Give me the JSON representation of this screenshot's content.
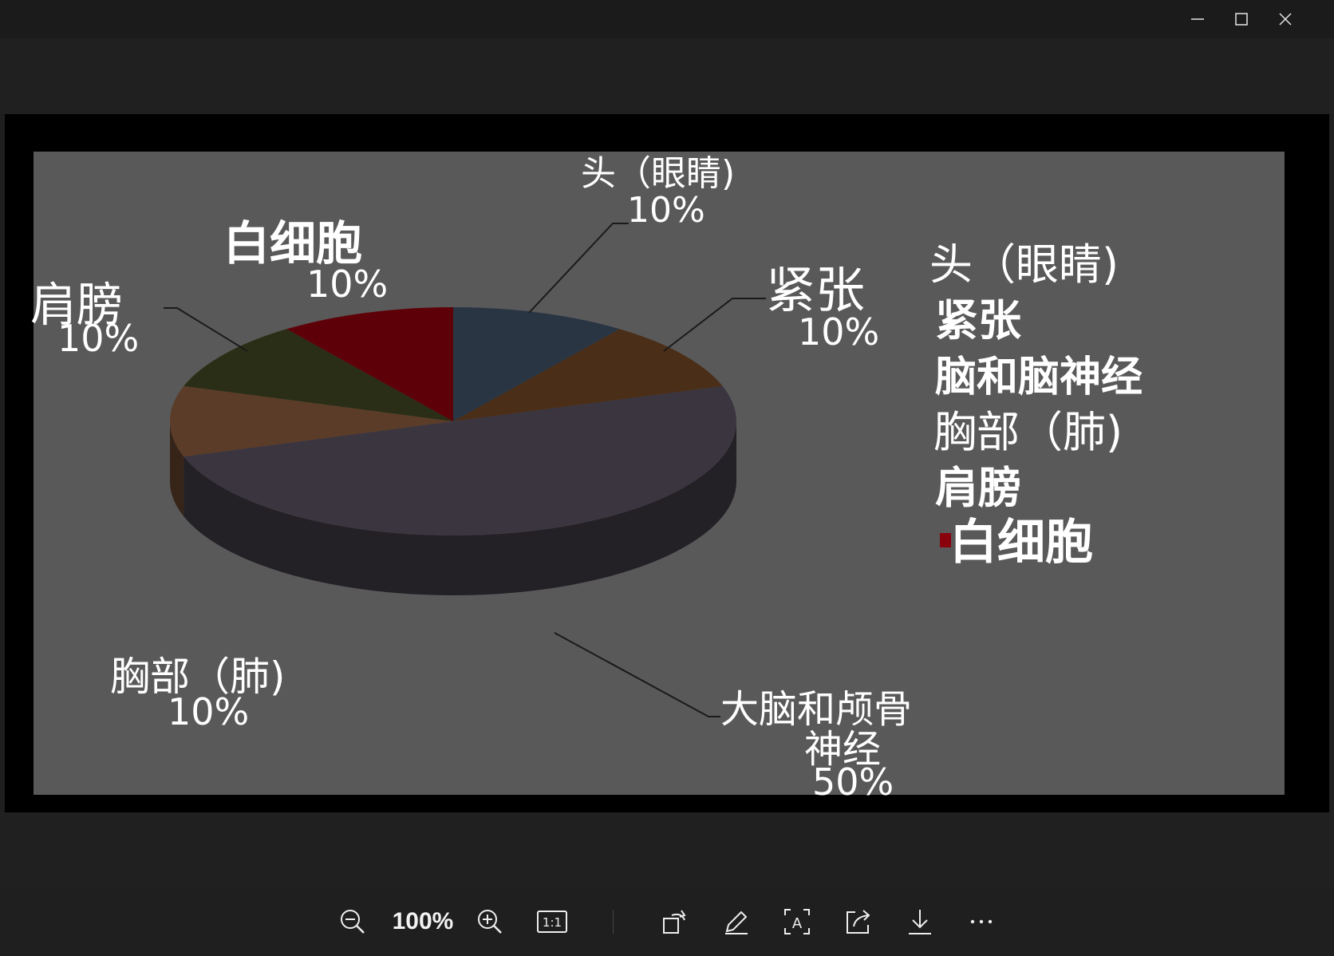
{
  "window": {
    "controls": [
      {
        "name": "minimize-icon"
      },
      {
        "name": "maximize-icon"
      },
      {
        "name": "close-icon"
      }
    ]
  },
  "toolbar": {
    "zoom_level": "100%",
    "actual_size_label": "1:1",
    "icons": [
      "zoom-out-icon",
      "zoom-in-icon",
      "actual-size-icon",
      "rotate-icon",
      "edit-icon",
      "text-recognition-icon",
      "share-icon",
      "download-icon",
      "more-icon"
    ]
  },
  "chart_data": {
    "type": "pie",
    "three_d": true,
    "slices": [
      {
        "label": "头（眼睛)",
        "value": 10,
        "value_label": "10%",
        "color": "#2a3544"
      },
      {
        "label": "紧张",
        "value": 10,
        "value_label": "10%",
        "color": "#4a2e18"
      },
      {
        "label": "大脑和颅骨\n神经",
        "value": 50,
        "value_label": "50%",
        "color": "#3b3540"
      },
      {
        "label": "胸部（肺)",
        "value": 10,
        "value_label": "10%",
        "color": "#5a3c28"
      },
      {
        "label": "肩膀",
        "value": 10,
        "value_label": "10%",
        "color": "#2a2e16"
      },
      {
        "label": "白细胞",
        "value": 10,
        "value_label": "10%",
        "color": "#5e0008"
      }
    ],
    "slice_label_lines": {
      "head": [
        "头（眼睛)",
        "10%"
      ],
      "tension": [
        "紧张",
        "10%"
      ],
      "brain": [
        "大脑和颅骨",
        "神经",
        "50%"
      ],
      "chest": [
        "胸部（肺)",
        "10%"
      ],
      "shoulder": [
        "肩膀",
        "10%"
      ],
      "wbc": [
        "白细胞",
        "10%"
      ]
    },
    "legend": {
      "position": "right",
      "entries": [
        "头（眼睛)",
        "紧张",
        "脑和脑神经",
        "胸部（肺)",
        "肩膀",
        "白细胞"
      ]
    },
    "plot_background": "#595959"
  }
}
